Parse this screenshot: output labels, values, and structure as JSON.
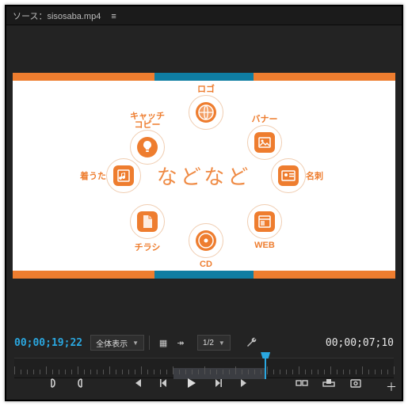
{
  "tab": {
    "label": "ソース：sisosaba.mp4",
    "menu_icon": "≡"
  },
  "preview": {
    "center_text": "などなど",
    "nodes": [
      {
        "id": "logo",
        "label": "ロゴ"
      },
      {
        "id": "banner",
        "label": "バナー"
      },
      {
        "id": "meishi",
        "label": "名刺"
      },
      {
        "id": "web",
        "label": "WEB"
      },
      {
        "id": "cd",
        "label": "CD"
      },
      {
        "id": "flyer",
        "label": "チラシ"
      },
      {
        "id": "chakuuta",
        "label": "着うた"
      },
      {
        "id": "catch",
        "label": "キャッチ\nコピー"
      }
    ]
  },
  "controls": {
    "tc_in": "00;00;19;22",
    "tc_out": "00;00;07;10",
    "fit_select": {
      "value": "全体表示"
    },
    "res_select": {
      "value": "1/2"
    }
  },
  "transport": {
    "buttons": [
      "mark-in",
      "mark-out",
      "goto-in",
      "step-back",
      "play",
      "step-fwd",
      "goto-out",
      "insert",
      "overwrite",
      "export"
    ]
  }
}
